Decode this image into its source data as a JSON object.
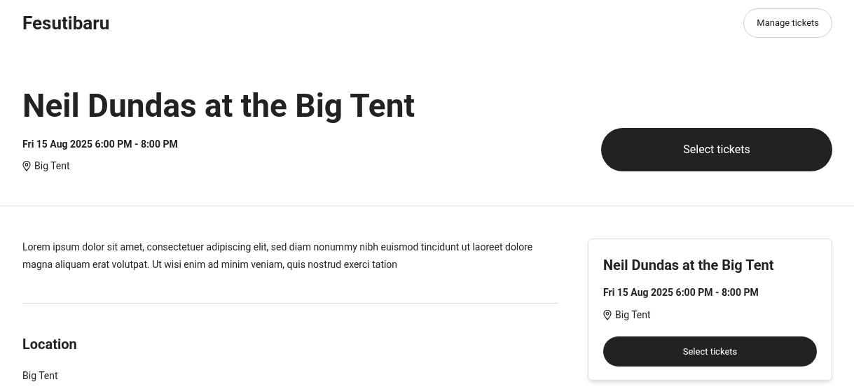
{
  "header": {
    "logo": "Fesutibaru",
    "manage_button": "Manage tickets"
  },
  "event": {
    "title": "Neil Dundas at the Big Tent",
    "datetime": "Fri 15 Aug 2025 6:00 PM - 8:00 PM",
    "venue": "Big Tent",
    "select_button": "Select tickets"
  },
  "description": "Lorem ipsum dolor sit amet, consectetuer adipiscing elit, sed diam nonummy nibh euismod tincidunt ut laoreet dolore magna aliquam erat volutpat. Ut wisi enim ad minim veniam, quis nostrud exerci tation",
  "location": {
    "heading": "Location",
    "venue": "Big Tent"
  },
  "summary_card": {
    "title": "Neil Dundas at the Big Tent",
    "datetime": "Fri 15 Aug 2025 6:00 PM - 8:00 PM",
    "venue": "Big Tent",
    "select_button": "Select tickets"
  }
}
